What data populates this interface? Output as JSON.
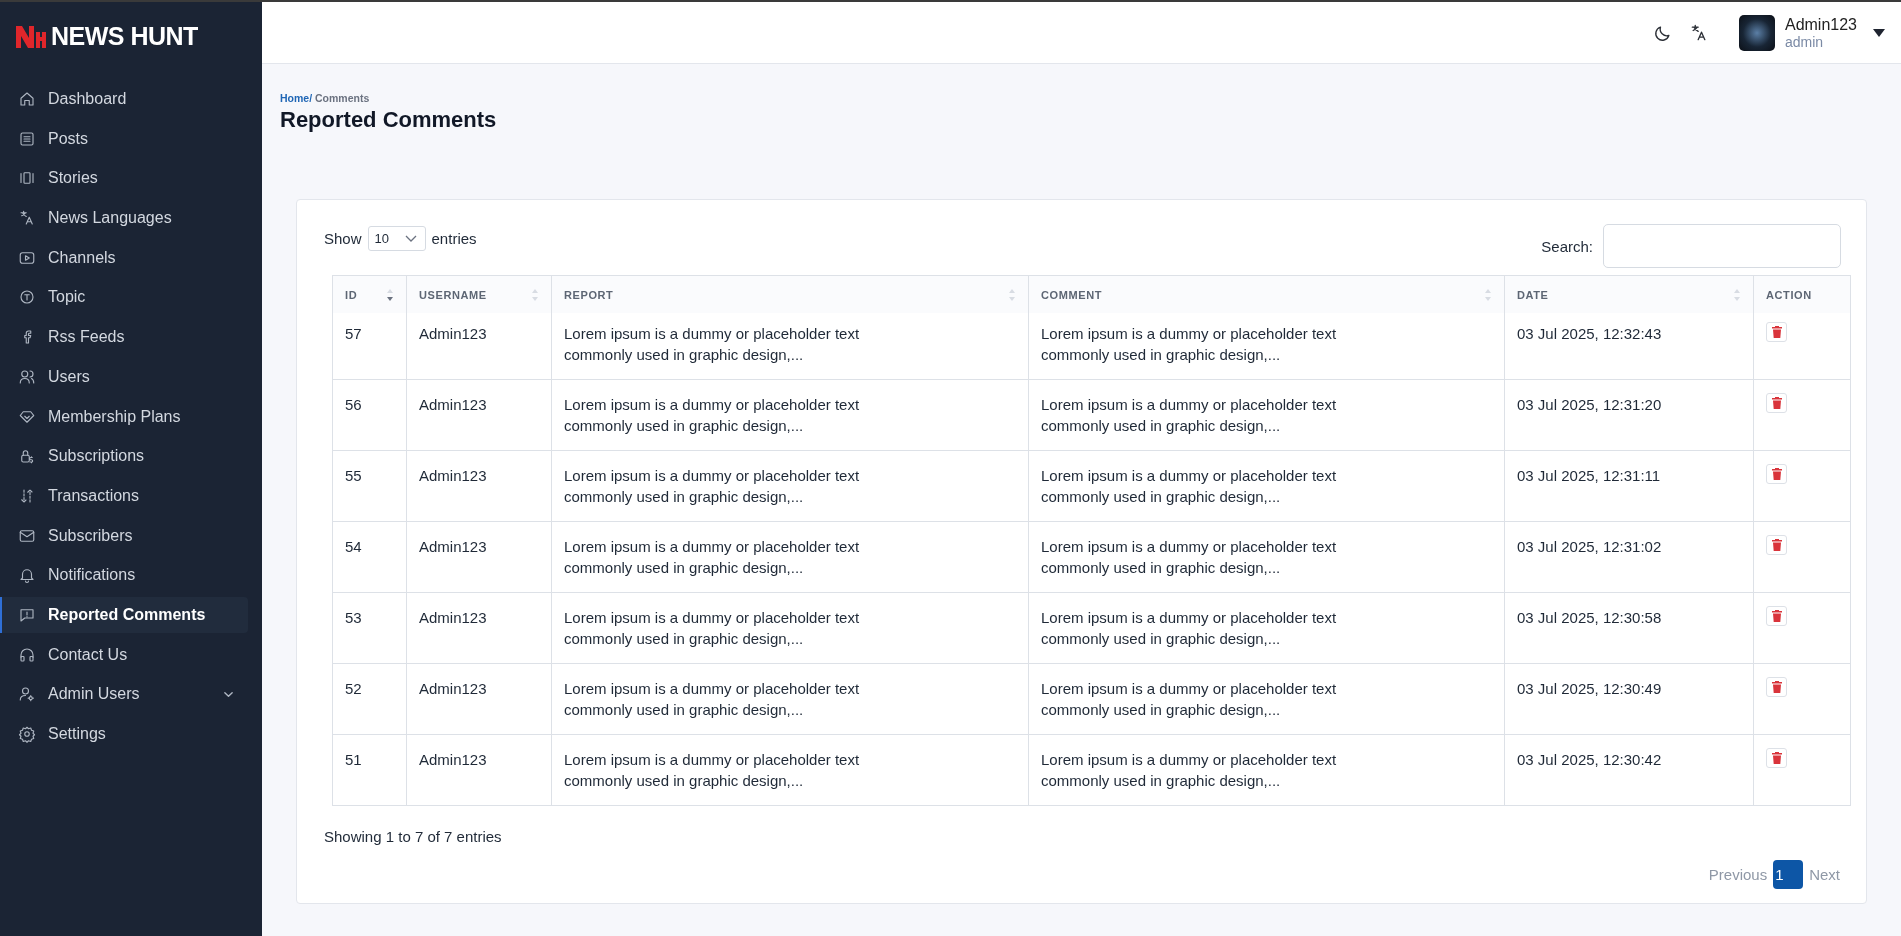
{
  "brand": {
    "name": "NEWS HUNT"
  },
  "sidebar": {
    "items": [
      {
        "label": "Dashboard",
        "selected": false,
        "expandable": false
      },
      {
        "label": "Posts",
        "selected": false,
        "expandable": false
      },
      {
        "label": "Stories",
        "selected": false,
        "expandable": false
      },
      {
        "label": "News Languages",
        "selected": false,
        "expandable": false
      },
      {
        "label": "Channels",
        "selected": false,
        "expandable": false
      },
      {
        "label": "Topic",
        "selected": false,
        "expandable": false
      },
      {
        "label": "Rss Feeds",
        "selected": false,
        "expandable": false
      },
      {
        "label": "Users",
        "selected": false,
        "expandable": false
      },
      {
        "label": "Membership Plans",
        "selected": false,
        "expandable": false
      },
      {
        "label": "Subscriptions",
        "selected": false,
        "expandable": false
      },
      {
        "label": "Transactions",
        "selected": false,
        "expandable": false
      },
      {
        "label": "Subscribers",
        "selected": false,
        "expandable": false
      },
      {
        "label": "Notifications",
        "selected": false,
        "expandable": false
      },
      {
        "label": "Reported Comments",
        "selected": true,
        "expandable": false
      },
      {
        "label": "Contact Us",
        "selected": false,
        "expandable": false
      },
      {
        "label": "Admin Users",
        "selected": false,
        "expandable": true
      },
      {
        "label": "Settings",
        "selected": false,
        "expandable": false
      }
    ]
  },
  "header": {
    "user": {
      "name": "Admin123",
      "role": "admin"
    }
  },
  "breadcrumb": [
    {
      "label": "Home/",
      "kind": "link"
    },
    {
      "label": " Comments",
      "kind": "current"
    }
  ],
  "page_title": "Reported Comments",
  "table_controls": {
    "show_label": "Show",
    "page_size": "10",
    "entries_label": "entries",
    "search_label": "Search:"
  },
  "table": {
    "columns": [
      {
        "label": "ID",
        "sortable": true,
        "sorted": true
      },
      {
        "label": "USERNAME",
        "sortable": true,
        "sorted": false
      },
      {
        "label": "REPORT",
        "sortable": true,
        "sorted": false
      },
      {
        "label": "COMMENT",
        "sortable": true,
        "sorted": false
      },
      {
        "label": "DATE",
        "sortable": true,
        "sorted": false
      },
      {
        "label": "ACTION",
        "sortable": false,
        "sorted": false
      }
    ],
    "rows": [
      {
        "id": "57",
        "username": "Admin123",
        "report": "Lorem ipsum is a dummy or placeholder text commonly used in graphic design,...",
        "comment": "Lorem ipsum is a dummy or placeholder text commonly used in graphic design,...",
        "date": "03 Jul 2025, 12:32:43"
      },
      {
        "id": "56",
        "username": "Admin123",
        "report": "Lorem ipsum is a dummy or placeholder text commonly used in graphic design,...",
        "comment": "Lorem ipsum is a dummy or placeholder text commonly used in graphic design,...",
        "date": "03 Jul 2025, 12:31:20"
      },
      {
        "id": "55",
        "username": "Admin123",
        "report": "Lorem ipsum is a dummy or placeholder text commonly used in graphic design,...",
        "comment": "Lorem ipsum is a dummy or placeholder text commonly used in graphic design,...",
        "date": "03 Jul 2025, 12:31:11"
      },
      {
        "id": "54",
        "username": "Admin123",
        "report": "Lorem ipsum is a dummy or placeholder text commonly used in graphic design,...",
        "comment": "Lorem ipsum is a dummy or placeholder text commonly used in graphic design,...",
        "date": "03 Jul 2025, 12:31:02"
      },
      {
        "id": "53",
        "username": "Admin123",
        "report": "Lorem ipsum is a dummy or placeholder text commonly used in graphic design,...",
        "comment": "Lorem ipsum is a dummy or placeholder text commonly used in graphic design,...",
        "date": "03 Jul 2025, 12:30:58"
      },
      {
        "id": "52",
        "username": "Admin123",
        "report": "Lorem ipsum is a dummy or placeholder text commonly used in graphic design,...",
        "comment": "Lorem ipsum is a dummy or placeholder text commonly used in graphic design,...",
        "date": "03 Jul 2025, 12:30:49"
      },
      {
        "id": "51",
        "username": "Admin123",
        "report": "Lorem ipsum is a dummy or placeholder text commonly used in graphic design,...",
        "comment": "Lorem ipsum is a dummy or placeholder text commonly used in graphic design,...",
        "date": "03 Jul 2025, 12:30:42"
      }
    ]
  },
  "table_footer": {
    "info": "Showing 1 to 7 of 7 entries"
  },
  "pagination": [
    {
      "label": "Previous",
      "disabled": true,
      "selected": false
    },
    {
      "label": "1",
      "disabled": false,
      "selected": true
    },
    {
      "label": "Next",
      "disabled": true,
      "selected": false
    }
  ]
}
